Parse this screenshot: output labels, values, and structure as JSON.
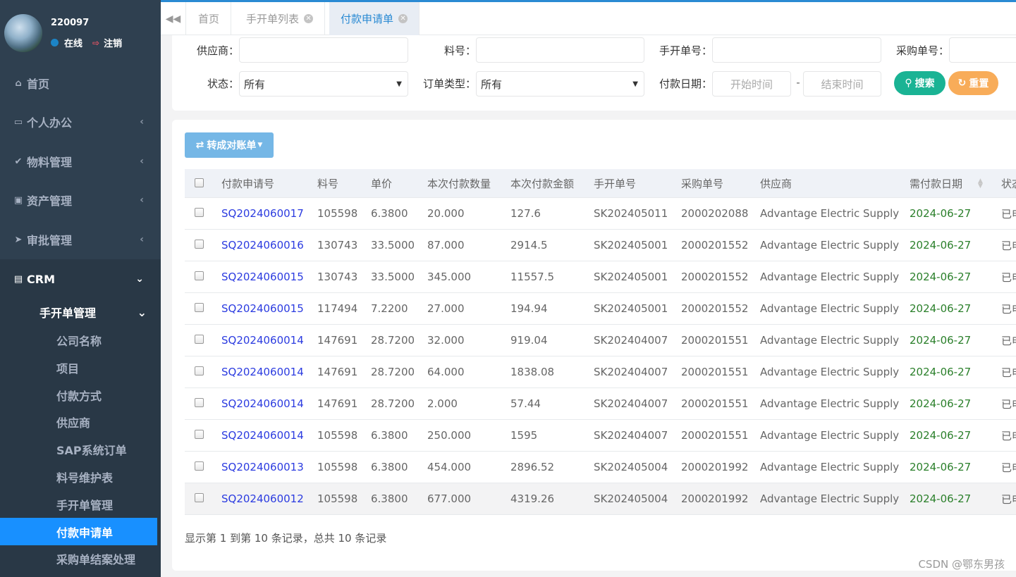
{
  "sidebar": {
    "user": {
      "name": "220097",
      "status": "在线",
      "logout": "注销"
    },
    "items": [
      {
        "label": "首页",
        "icon": "home-icon"
      },
      {
        "label": "个人办公",
        "icon": "laptop-icon"
      },
      {
        "label": "物料管理",
        "icon": "check-icon"
      },
      {
        "label": "资产管理",
        "icon": "money-icon"
      },
      {
        "label": "审批管理",
        "icon": "send-icon"
      },
      {
        "label": "CRM",
        "icon": "contact-icon"
      }
    ],
    "crm_group": "手开单管理",
    "crm_items": [
      "公司名称",
      "项目",
      "付款方式",
      "供应商",
      "SAP系统订单",
      "料号维护表",
      "手开单管理",
      "付款申请单",
      "采购单结案处理"
    ],
    "active_item": "付款申请单",
    "active_color": "#1890ff"
  },
  "tabs": [
    {
      "label": "首页"
    },
    {
      "label": "手开单列表"
    },
    {
      "label": "付款申请单"
    }
  ],
  "search": {
    "supplier_label": "供应商：",
    "part_label": "料号：",
    "manual_label": "手开单号：",
    "po_label": "采购单号：",
    "status_label": "状态：",
    "status_value": "所有",
    "order_type_label": "订单类型：",
    "order_type_value": "所有",
    "pay_date_label": "付款日期：",
    "start_placeholder": "开始时间",
    "dash": "-",
    "end_placeholder": "结束时间",
    "search_btn": "搜索",
    "reset_btn": "重置"
  },
  "toolbar": {
    "convert_btn": "转成对账单"
  },
  "table": {
    "columns": [
      "付款申请号",
      "料号",
      "单价",
      "本次付款数量",
      "本次付款金额",
      "手开单号",
      "采购单号",
      "供应商",
      "需付款日期",
      "状态"
    ],
    "rows": [
      [
        "SQ2024060017",
        "105598",
        "6.3800",
        "20.000",
        "127.6",
        "SK202405011",
        "2000202088",
        "Advantage Electric Supply",
        "2024-06-27",
        "已申"
      ],
      [
        "SQ2024060016",
        "130743",
        "33.5000",
        "87.000",
        "2914.5",
        "SK202405001",
        "2000201552",
        "Advantage Electric Supply",
        "2024-06-27",
        "已申"
      ],
      [
        "SQ2024060015",
        "130743",
        "33.5000",
        "345.000",
        "11557.5",
        "SK202405001",
        "2000201552",
        "Advantage Electric Supply",
        "2024-06-27",
        "已申"
      ],
      [
        "SQ2024060015",
        "117494",
        "7.2200",
        "27.000",
        "194.94",
        "SK202405001",
        "2000201552",
        "Advantage Electric Supply",
        "2024-06-27",
        "已申"
      ],
      [
        "SQ2024060014",
        "147691",
        "28.7200",
        "32.000",
        "919.04",
        "SK202404007",
        "2000201551",
        "Advantage Electric Supply",
        "2024-06-27",
        "已申"
      ],
      [
        "SQ2024060014",
        "147691",
        "28.7200",
        "64.000",
        "1838.08",
        "SK202404007",
        "2000201551",
        "Advantage Electric Supply",
        "2024-06-27",
        "已申"
      ],
      [
        "SQ2024060014",
        "147691",
        "28.7200",
        "2.000",
        "57.44",
        "SK202404007",
        "2000201551",
        "Advantage Electric Supply",
        "2024-06-27",
        "已申"
      ],
      [
        "SQ2024060014",
        "105598",
        "6.3800",
        "250.000",
        "1595",
        "SK202404007",
        "2000201551",
        "Advantage Electric Supply",
        "2024-06-27",
        "已申"
      ],
      [
        "SQ2024060013",
        "105598",
        "6.3800",
        "454.000",
        "2896.52",
        "SK202405004",
        "2000201992",
        "Advantage Electric Supply",
        "2024-06-27",
        "已申"
      ],
      [
        "SQ2024060012",
        "105598",
        "6.3800",
        "677.000",
        "4319.26",
        "SK202405004",
        "2000201992",
        "Advantage Electric Supply",
        "2024-06-27",
        "已申"
      ]
    ]
  },
  "pagination_text": "显示第 1 到第 10 条记录，总共 10 条记录",
  "watermark": "CSDN @鄂东男孩"
}
